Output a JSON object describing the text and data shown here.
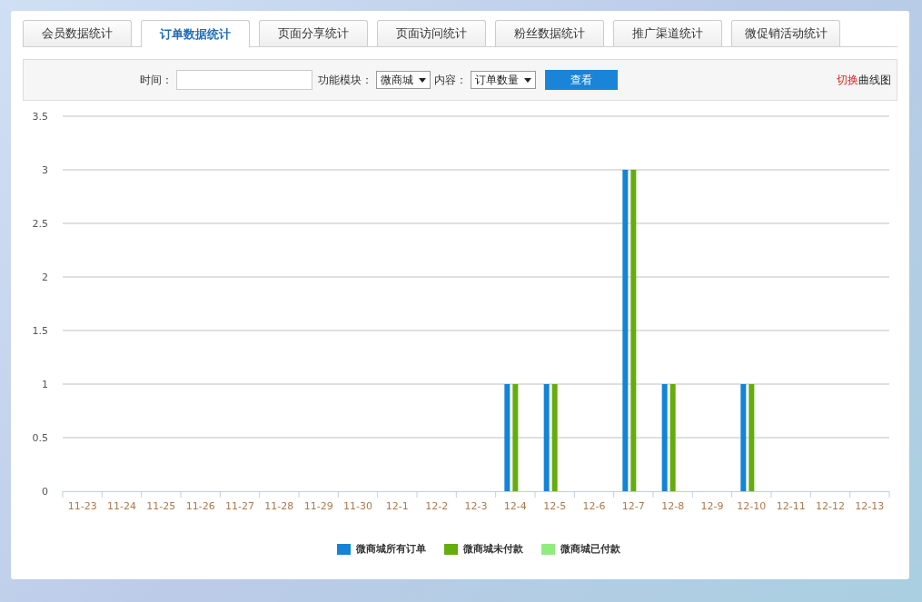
{
  "tabs": [
    {
      "label": "会员数据统计",
      "selected": false
    },
    {
      "label": "订单数据统计",
      "selected": true
    },
    {
      "label": "页面分享统计",
      "selected": false
    },
    {
      "label": "页面访问统计",
      "selected": false
    },
    {
      "label": "粉丝数据统计",
      "selected": false
    },
    {
      "label": "推广渠道统计",
      "selected": false
    },
    {
      "label": "微促销活动统计",
      "selected": false
    }
  ],
  "filters": {
    "time_label": "时间：",
    "module_label": "功能模块：",
    "module_value": "微商城",
    "content_label": "内容：",
    "content_value": "订单数量",
    "view_button": "查看"
  },
  "toggle_link": {
    "highlight": "切换",
    "label": "曲线图"
  },
  "chart": {
    "chart_data": {
      "type": "bar",
      "categories": [
        "11-23",
        "11-24",
        "11-25",
        "11-26",
        "11-27",
        "11-28",
        "11-29",
        "11-30",
        "12-1",
        "12-2",
        "12-3",
        "12-4",
        "12-5",
        "12-6",
        "12-7",
        "12-8",
        "12-9",
        "12-10",
        "12-11",
        "12-12",
        "12-13"
      ],
      "grid": true,
      "legend": "bottom",
      "ylim": [
        0,
        3.5
      ],
      "yticks": [
        0,
        {
          "value": 0.5,
          "label": "0.5"
        },
        {
          "value": 1,
          "label": "1"
        },
        {
          "value": 1.5,
          "label": "1.5"
        },
        {
          "value": 2,
          "label": "2"
        },
        {
          "value": 2.5,
          "label": "2.5"
        },
        {
          "value": 3,
          "label": "3"
        },
        {
          "value": 3.5,
          "label": "3.5"
        }
      ],
      "series": [
        {
          "name": "微商城所有订单",
          "color": "#1384d6",
          "values": [
            0,
            0,
            0,
            0,
            0,
            0,
            0,
            0,
            0,
            0,
            0,
            1,
            1,
            0,
            3,
            1,
            0,
            1,
            0,
            0,
            0
          ]
        },
        {
          "name": "微商城未付款",
          "color": "#64ad0c",
          "values": [
            0,
            0,
            0,
            0,
            0,
            0,
            0,
            0,
            0,
            0,
            0,
            1,
            1,
            0,
            3,
            1,
            0,
            1,
            0,
            0,
            0
          ]
        },
        {
          "name": "微商城已付款",
          "color": "#90ec7d",
          "values": [
            0,
            0,
            0,
            0,
            0,
            0,
            0,
            0,
            0,
            0,
            0,
            0,
            0,
            0,
            0,
            0,
            0,
            0,
            0,
            0,
            0
          ]
        }
      ]
    }
  }
}
